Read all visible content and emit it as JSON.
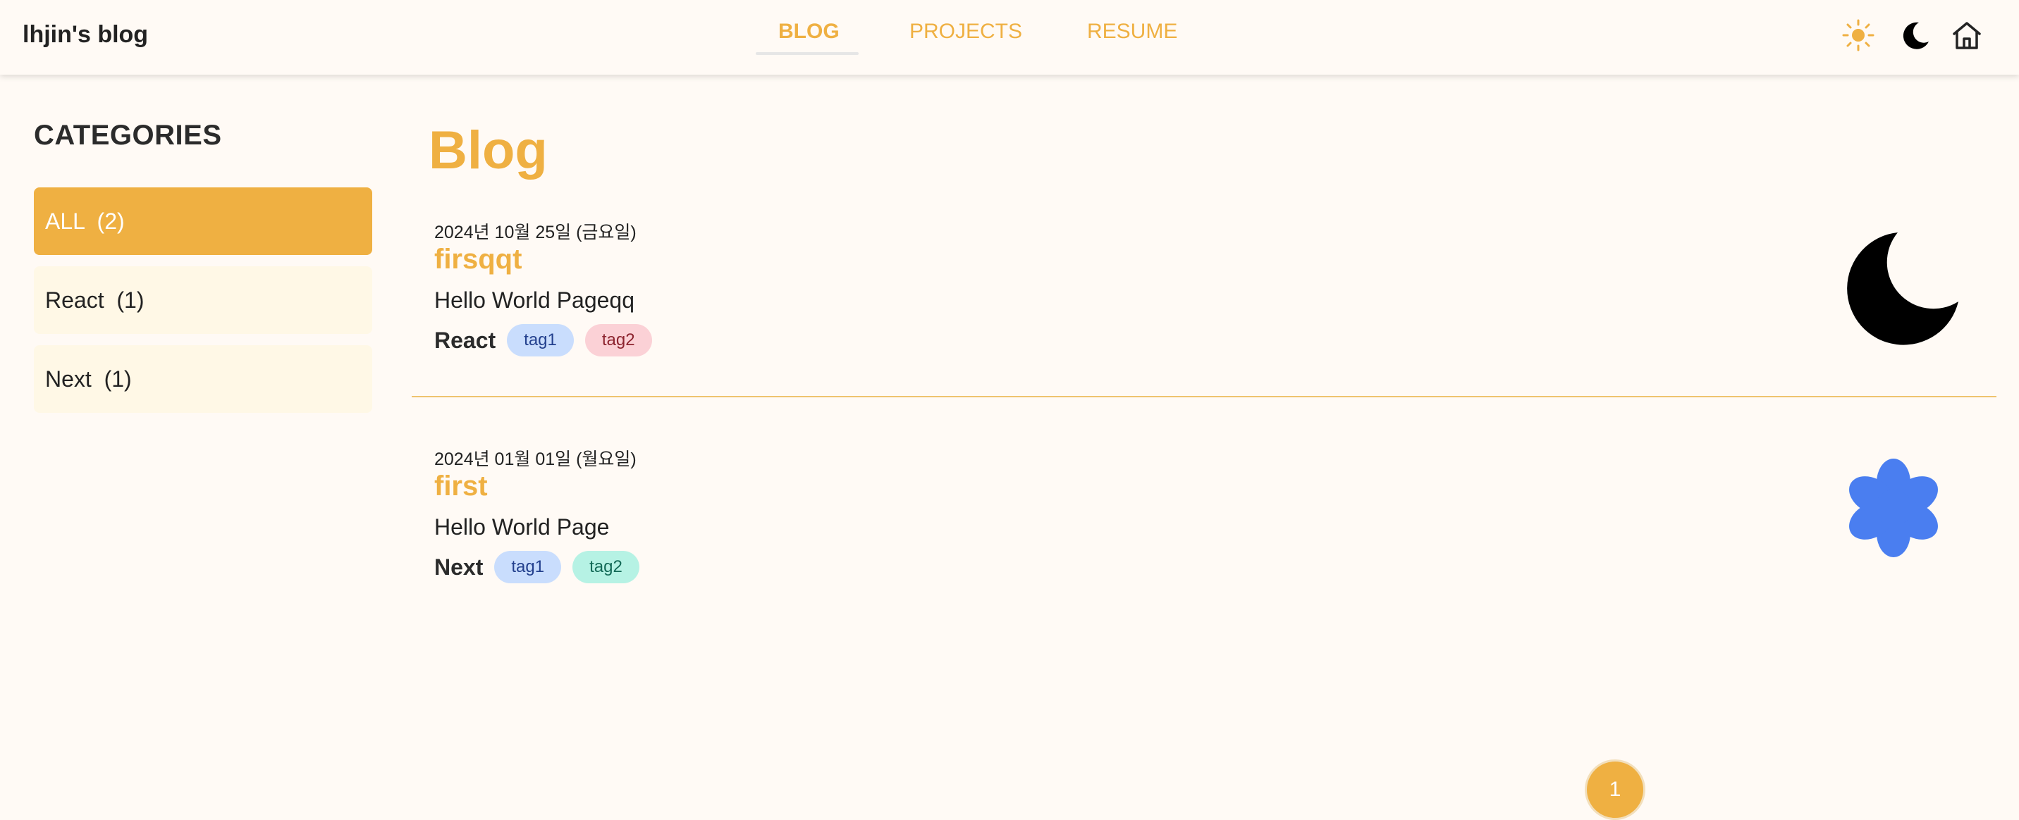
{
  "header": {
    "brand": "lhjin's blog",
    "nav": [
      "BLOG",
      "PROJECTS",
      "RESUME"
    ],
    "icons": [
      "sun-icon",
      "moon-icon",
      "home-icon"
    ]
  },
  "sidebar": {
    "heading": "CATEGORIES",
    "items": [
      {
        "label": "ALL  (2)",
        "active": true
      },
      {
        "label": "React  (1)"
      },
      {
        "label": "Next  (1)"
      }
    ]
  },
  "main": {
    "title": "Blog",
    "posts": [
      {
        "date": "2024년 10월 25일 (금요일)",
        "title": "firsqqt",
        "description": "Hello World Pageqq",
        "category": "React",
        "tags": [
          "tag1",
          "tag2"
        ],
        "thumbnail": "crescent-moon-icon"
      },
      {
        "date": "2024년 01월 01일 (월요일)",
        "title": "first",
        "description": "Hello World Page",
        "category": "Next",
        "tags": [
          "tag1",
          "tag2"
        ],
        "thumbnail": "blue-flower-icon"
      }
    ]
  },
  "pagination": {
    "current": "1"
  },
  "colors": {
    "accent": "#efb042",
    "background": "#fffaf5",
    "category_bg": "#fff8e6",
    "flower": "#4a7ef0"
  }
}
